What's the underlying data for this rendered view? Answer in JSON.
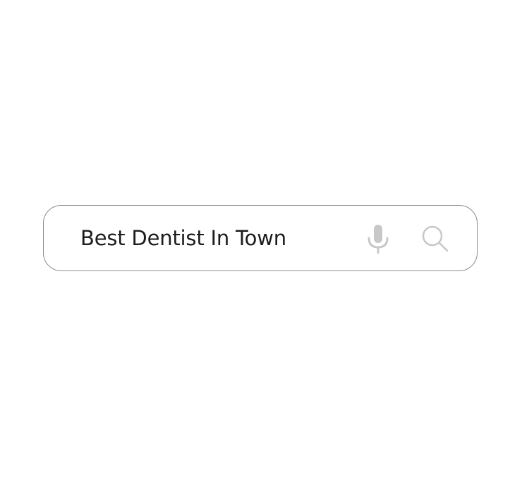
{
  "search": {
    "value": "Best Dentist In Town"
  },
  "icons": {
    "microphone": "microphone-icon",
    "search": "search-icon"
  },
  "colors": {
    "border": "#8a8a8a",
    "text": "#1c1c1c",
    "icon": "#c8c8c8",
    "background": "#ffffff"
  }
}
